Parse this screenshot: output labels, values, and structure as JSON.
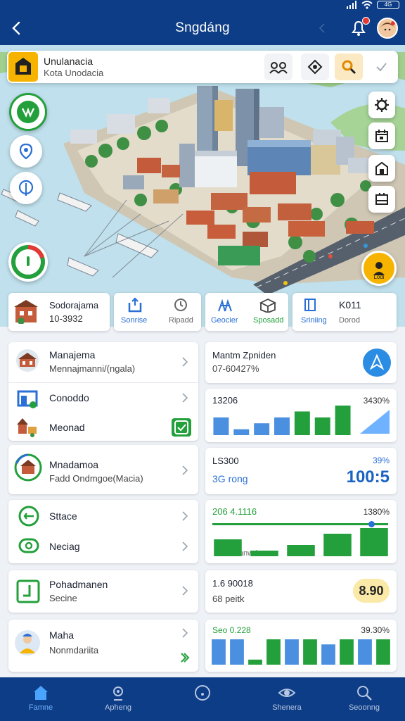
{
  "app": {
    "title": "Sngdáng",
    "accent": "#0d3d86",
    "green": "#23a03b",
    "blue": "#2a6fd6"
  },
  "statusbar": {
    "battery": "4G"
  },
  "search": {
    "title": "Unulanacia",
    "subtitle": "Kota Unodacia",
    "buttons": [
      "people-icon",
      "map-pin-icon",
      "search-icon",
      "check-icon"
    ]
  },
  "map": {
    "fab_label": "Lodi"
  },
  "quick": [
    {
      "title": "Sodorajama",
      "subtitle": "10-3932"
    },
    {
      "label_a": "Sonrise",
      "label_b": "Ripadd"
    },
    {
      "label_a": "Geocier",
      "label_b": "Sposadd"
    },
    {
      "label_a": "Sriniing",
      "title": "K011",
      "label_b": "Dorod"
    }
  ],
  "list": [
    {
      "title": "Manajema",
      "subtitle": "Mennajmanni/(ngala)"
    },
    {
      "title": "Conoddo"
    },
    {
      "title": "Meonad"
    },
    {
      "title": "Mnadamoa",
      "subtitle": "Fadd Ondmgoe(Macia)"
    },
    {
      "title": "Sttace"
    },
    {
      "title": "Neciag"
    },
    {
      "title": "Pohadmanen",
      "subtitle": "Secine"
    },
    {
      "title": "Maha",
      "subtitle": "Nonmdariita"
    }
  ],
  "stats": [
    {
      "title": "Mantm Zpniden",
      "subtitle": "07-60427%"
    },
    {
      "title": "13206",
      "pct": "3430%"
    },
    {
      "title": "LS300",
      "subtitle": "3G rong",
      "pct": "39%",
      "value": "100:5"
    },
    {
      "title": "206 4.1116",
      "pct": "1380%",
      "caption": "Danwris"
    },
    {
      "title": "1.6 90018",
      "subtitle": "68 peitk",
      "badge": "8.90"
    },
    {
      "title": "Seo 0.228",
      "pct": "39.30%"
    }
  ],
  "chart_data": [
    {
      "type": "bar",
      "values": [
        3,
        1,
        2,
        3,
        4,
        3,
        5
      ]
    },
    {
      "type": "bar",
      "values": [
        3,
        1,
        2,
        4,
        5
      ]
    },
    {
      "type": "bar",
      "values": [
        5,
        5,
        1,
        5,
        5,
        5,
        4,
        5,
        5,
        5
      ]
    }
  ],
  "nav": [
    {
      "label": "Famne",
      "icon": "home-icon"
    },
    {
      "label": "Apheng",
      "icon": "profile-icon"
    },
    {
      "label": "",
      "icon": "circle-icon"
    },
    {
      "label": "Shenera",
      "icon": "eye-icon"
    },
    {
      "label": "Seoonng",
      "icon": "search-icon"
    }
  ]
}
